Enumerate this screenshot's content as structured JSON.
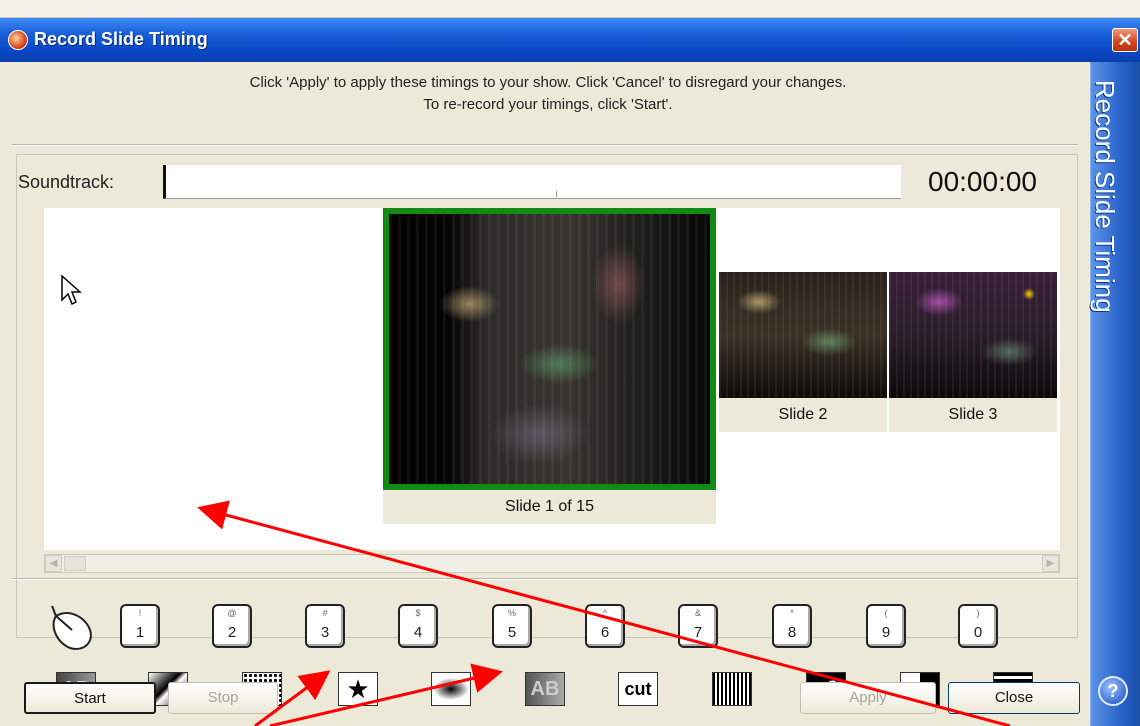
{
  "window": {
    "title": "Record Slide Timing",
    "side_title": "Record Slide Timing"
  },
  "instructions": {
    "line1": "Click 'Apply' to apply these timings to your show. Click 'Cancel' to disregard your changes.",
    "line2": "To re-record your timings, click 'Start'."
  },
  "soundtrack": {
    "label": "Soundtrack:",
    "time": "00:00:00"
  },
  "slides": {
    "current_caption": "Slide 1 of 15",
    "next": [
      "Slide 2",
      "Slide 3"
    ]
  },
  "keys": [
    {
      "sym": "!",
      "num": "1"
    },
    {
      "sym": "@",
      "num": "2"
    },
    {
      "sym": "#",
      "num": "3"
    },
    {
      "sym": "$",
      "num": "4"
    },
    {
      "sym": "%",
      "num": "5"
    },
    {
      "sym": "^",
      "num": "6"
    },
    {
      "sym": "&",
      "num": "7"
    },
    {
      "sym": "*",
      "num": "8"
    },
    {
      "sym": "(",
      "num": "9"
    },
    {
      "sym": ")",
      "num": "0"
    }
  ],
  "effects": [
    "AB",
    "",
    "",
    "★",
    "",
    "AB",
    "cut",
    "",
    "♥2",
    "",
    ""
  ],
  "buttons": {
    "start": "Start",
    "stop": "Stop",
    "apply": "Apply",
    "close": "Close"
  },
  "colors": {
    "title_bar": "#0a4ac8",
    "selected_border": "#138a13",
    "annotation": "#ff0000"
  }
}
